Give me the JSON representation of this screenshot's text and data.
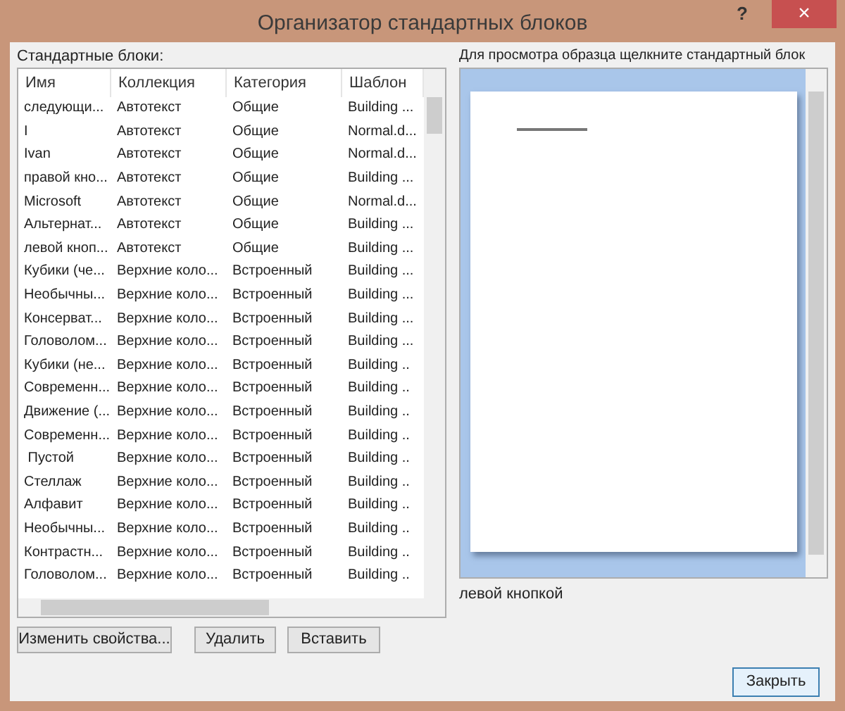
{
  "window": {
    "title": "Организатор стандартных блоков",
    "help_button": "?",
    "close_button": "×"
  },
  "list_label": "Стандартные блоки:",
  "table": {
    "columns": [
      "Имя",
      "Коллекция",
      "Категория",
      "Шаблон"
    ],
    "rows": [
      [
        "следующи...",
        "Автотекст",
        "Общие",
        "Building ..."
      ],
      [
        "I",
        "Автотекст",
        "Общие",
        "Normal.d..."
      ],
      [
        "Ivan",
        "Автотекст",
        "Общие",
        "Normal.d..."
      ],
      [
        "правой кно...",
        "Автотекст",
        "Общие",
        "Building ..."
      ],
      [
        "Microsoft",
        "Автотекст",
        "Общие",
        "Normal.d..."
      ],
      [
        "Альтернат...",
        "Автотекст",
        "Общие",
        "Building ..."
      ],
      [
        "левой кноп...",
        "Автотекст",
        "Общие",
        "Building ..."
      ],
      [
        "Кубики (че...",
        "Верхние коло...",
        "Встроенный",
        "Building ..."
      ],
      [
        "Необычны...",
        "Верхние коло...",
        "Встроенный",
        "Building ..."
      ],
      [
        "Консерват...",
        "Верхние коло...",
        "Встроенный",
        "Building ..."
      ],
      [
        "Головолом...",
        "Верхние коло...",
        "Встроенный",
        "Building ..."
      ],
      [
        "Кубики (не...",
        "Верхние коло...",
        "Встроенный",
        "Building .."
      ],
      [
        "Современн...",
        "Верхние коло...",
        "Встроенный",
        "Building .."
      ],
      [
        "Движение (...",
        "Верхние коло...",
        "Встроенный",
        "Building .."
      ],
      [
        "Современн...",
        "Верхние коло...",
        "Встроенный",
        "Building .."
      ],
      [
        " Пустой",
        "Верхние коло...",
        "Встроенный",
        "Building .."
      ],
      [
        "Стеллаж",
        "Верхние коло...",
        "Встроенный",
        "Building .."
      ],
      [
        "Алфавит",
        "Верхние коло...",
        "Встроенный",
        "Building .."
      ],
      [
        "Необычны...",
        "Верхние коло...",
        "Встроенный",
        "Building .."
      ],
      [
        "Контрастн...",
        "Верхние коло...",
        "Встроенный",
        "Building .."
      ],
      [
        "Головолом...",
        "Верхние коло...",
        "Встроенный",
        "Building .."
      ]
    ]
  },
  "buttons": [
    "Изменить свойства...",
    "Удалить",
    "Вставить"
  ],
  "preview_label": "Для просмотра образца щелкните стандартный блок",
  "preview_caption": "левой кнопкой",
  "close_dialog_button": "Закрыть"
}
